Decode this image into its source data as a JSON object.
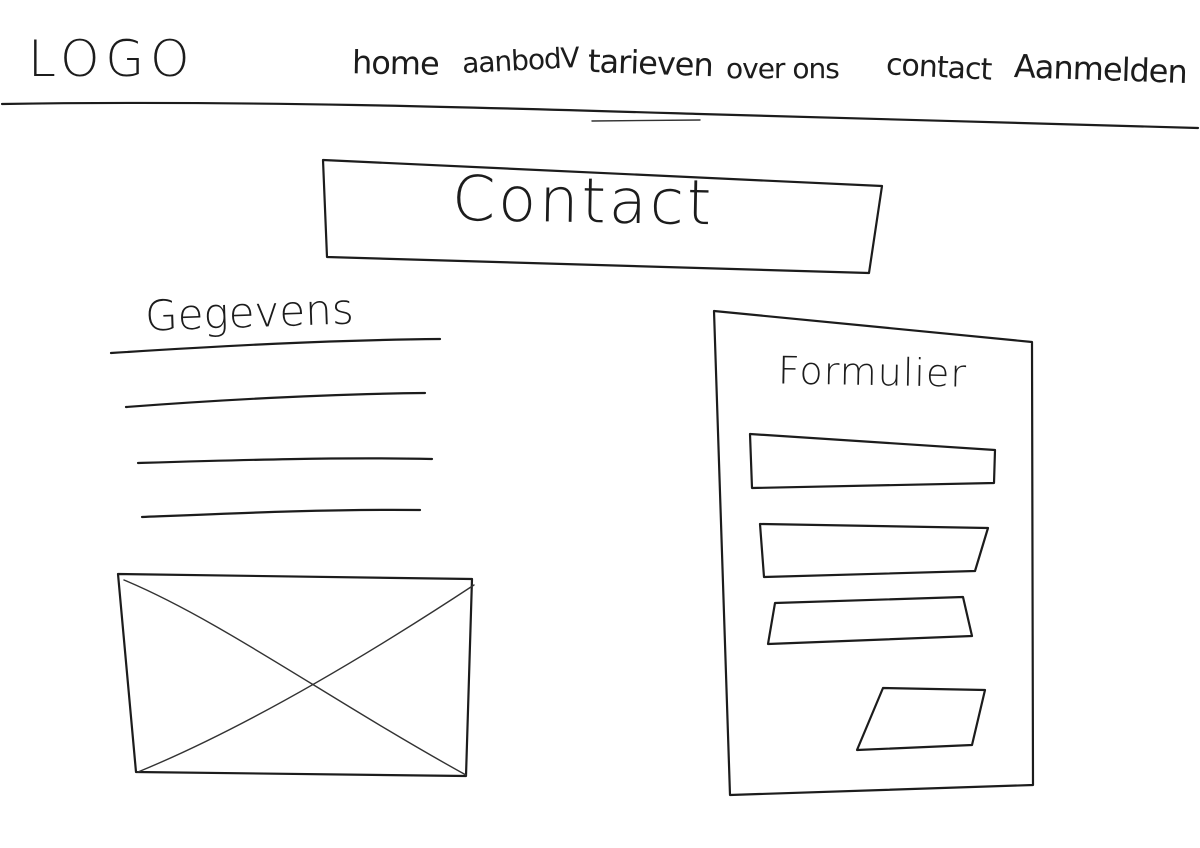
{
  "header": {
    "logo_text": "LOGO",
    "nav": {
      "home": "home",
      "aanbod": "aanbodV",
      "tarieven": "tarieven",
      "over_ons": "over ons",
      "contact": "contact",
      "aanmelden": "Aanmelden"
    }
  },
  "main": {
    "title": "Contact"
  },
  "details": {
    "title": "Gegevens",
    "line_count": 3
  },
  "form": {
    "title": "Formulier",
    "field_count": 3
  }
}
